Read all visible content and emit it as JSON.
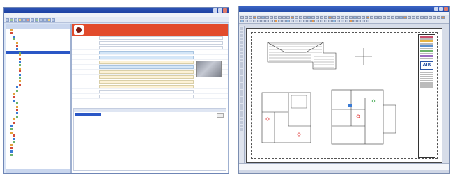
{
  "left_app": {
    "title": "",
    "menu": [],
    "tree": {
      "header": "",
      "footer": "",
      "nodes": [
        "",
        "",
        "",
        "",
        "",
        "",
        "",
        "",
        "",
        "",
        "",
        "",
        "",
        "",
        "",
        "",
        "",
        "",
        "",
        "",
        "",
        "",
        "",
        "",
        "",
        "",
        "",
        "",
        "",
        "",
        "",
        "",
        "",
        "",
        "",
        "",
        "",
        "",
        "",
        ""
      ],
      "selected_index": 7
    },
    "alert": {
      "header": "",
      "line1": "",
      "line2": ""
    },
    "fields": [
      {
        "label": "",
        "value": "",
        "style": "w"
      },
      {
        "label": "",
        "value": "",
        "style": "w"
      },
      {
        "label": "",
        "value": "",
        "style": "w"
      },
      {
        "label": "",
        "value": "",
        "style": "b"
      },
      {
        "label": "",
        "value": "",
        "style": "b"
      },
      {
        "label": "",
        "value": "",
        "style": "y"
      },
      {
        "label": "",
        "value": "",
        "style": "b"
      },
      {
        "label": "",
        "value": "",
        "style": "y"
      },
      {
        "label": "",
        "value": "",
        "style": "y"
      },
      {
        "label": "",
        "value": "",
        "style": "y"
      },
      {
        "label": "",
        "value": "",
        "style": "y"
      },
      {
        "label": "",
        "value": "",
        "style": "w"
      },
      {
        "label": "",
        "value": "",
        "style": "w"
      }
    ],
    "side_fields": [
      "",
      "",
      "",
      ""
    ],
    "notes": {
      "header": "",
      "selected": "",
      "lines": [
        "",
        "",
        "",
        "",
        ""
      ],
      "button": ""
    }
  },
  "right_app": {
    "title": "",
    "menu": [],
    "logo_text": "AIR",
    "command_lines": [
      "",
      ""
    ],
    "status": ""
  },
  "colors": {
    "alert_red": "#e24b2c",
    "selection_blue": "#2a57c6",
    "field_yellow": "#fdf2d6",
    "field_blue": "#d4e6f7",
    "title_blue": "#1b3f9f"
  }
}
